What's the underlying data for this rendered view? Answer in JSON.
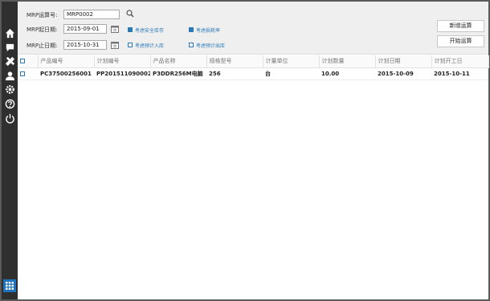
{
  "filters": {
    "mrp_no_label": "MRP运算号:",
    "mrp_no_value": "MRP0002",
    "start_label": "MRP起日期:",
    "start_value": "2015-09-01",
    "end_label": "MRP止日期:",
    "end_value": "2015-10-31",
    "options": [
      {
        "label": "考虑安全库存",
        "checked": true
      },
      {
        "label": "考虑损耗率",
        "checked": true
      },
      {
        "label": "考虑预计入库",
        "checked": false
      },
      {
        "label": "考虑预计出库",
        "checked": false
      }
    ]
  },
  "buttons": {
    "new": "新增运算",
    "start": "开始运算"
  },
  "table": {
    "headers": [
      "产品编号",
      "计划编号",
      "产品名称",
      "规格型号",
      "计量单位",
      "计划数量",
      "计划日期",
      "计划开工日"
    ],
    "rows": [
      [
        "PC37500256001",
        "PP201511090002",
        "P3DDR256M电脑",
        "256",
        "台",
        "10.00",
        "2015-10-09",
        "2015-10-11"
      ]
    ]
  },
  "sidebar": {
    "icons": [
      "home-icon",
      "chat-icon",
      "tools-icon",
      "user-icon",
      "gear-icon",
      "help-icon",
      "power-icon"
    ],
    "bottom": "grid-icon"
  },
  "colors": {
    "accent": "#2a7ab8",
    "sidebar": "#2f2f2f",
    "grid_button": "#1e73be"
  }
}
